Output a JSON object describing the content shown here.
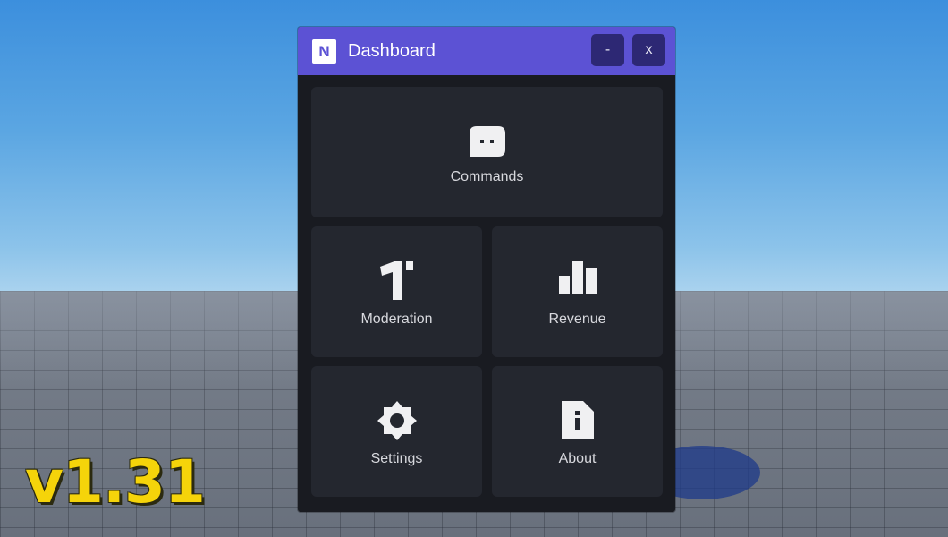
{
  "window": {
    "title": "Dashboard",
    "logo_letter": "N",
    "minimize_label": "-",
    "close_label": "x",
    "accent_color": "#5c52d4"
  },
  "tiles": [
    {
      "label": "Commands",
      "icon": "chat-bubble-icon"
    },
    {
      "label": "Moderation",
      "icon": "hammer-icon"
    },
    {
      "label": "Revenue",
      "icon": "bar-chart-icon"
    },
    {
      "label": "Settings",
      "icon": "gear-icon"
    },
    {
      "label": "About",
      "icon": "info-file-icon"
    }
  ],
  "version_label": "v1.31",
  "version_color": "#f5d40a"
}
